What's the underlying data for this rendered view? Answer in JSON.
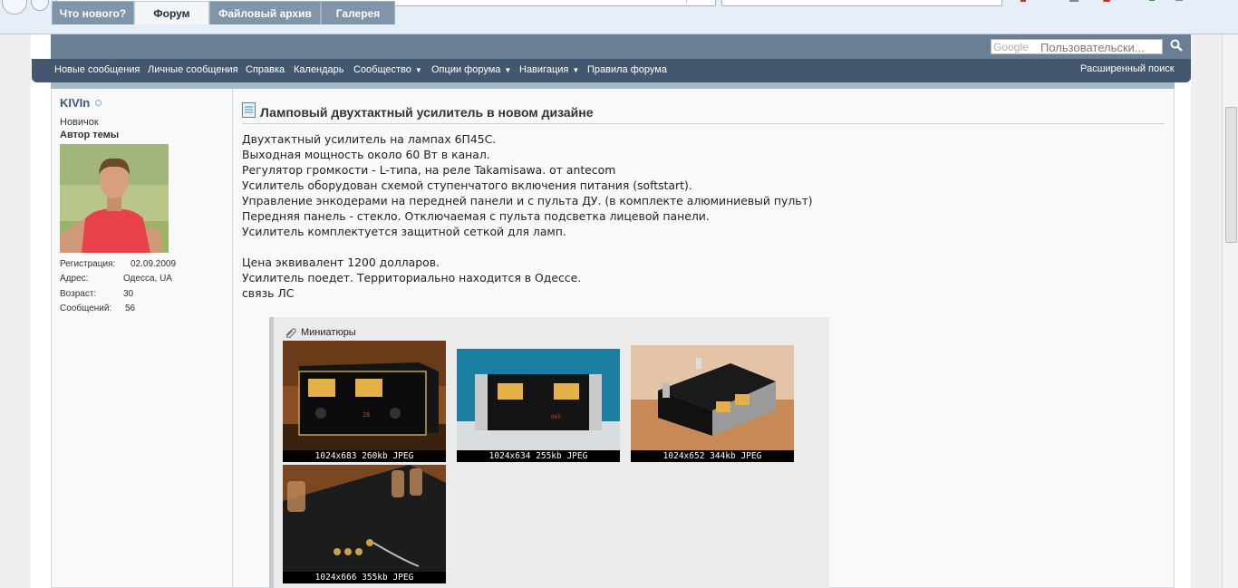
{
  "forum": {
    "tabs": [
      {
        "label": "Что нового?"
      },
      {
        "label": "Форум"
      },
      {
        "label": "Файловый архив"
      },
      {
        "label": "Галерея"
      }
    ],
    "search": {
      "engine": "Google",
      "placeholder": "Пользовательски..."
    },
    "subnav": [
      {
        "label": "Новые сообщения"
      },
      {
        "label": "Личные сообщения"
      },
      {
        "label": "Справка"
      },
      {
        "label": "Календарь"
      },
      {
        "label": "Сообщество"
      },
      {
        "label": "Опции форума"
      },
      {
        "label": "Навигация"
      },
      {
        "label": "Правила форума"
      }
    ],
    "advanced_search": "Расширенный поиск"
  },
  "user": {
    "name": "KIVIn",
    "rank": "Новичок",
    "role": "Автор темы",
    "stats": [
      {
        "label": "Регистрация:",
        "value": "02.09.2009"
      },
      {
        "label": "Адрес:",
        "value": "Одесса, UA"
      },
      {
        "label": "Возраст:",
        "value": "30"
      },
      {
        "label": "Сообщений:",
        "value": "56"
      }
    ]
  },
  "post": {
    "title": "Ламповый двухтактный усилитель в новом дизайне",
    "lines": [
      "Двухтактный усилитель на лампах 6П45С.",
      "Выходная мощность около 60 Вт в канал.",
      "Регулятор громкости - L-типа, на реле Takamisawa. от antecom",
      "Усилитель оборудован схемой ступенчатого включения питания (softstart).",
      "Управление энкодерами на передней панели и с пульта ДУ. (в комплекте алюминиевый пульт)",
      "Передняя панель - стекло. Отключаемая с пульта подсветка лицевой панели.",
      "Усилитель комплектуется защитной сеткой для ламп.",
      "",
      "Цена эквивалент 1200 долларов.",
      "Усилитель поедет. Территориально находится в Одессе.",
      "связь ЛС"
    ],
    "attachments_label": "Миниатюры",
    "attachments": [
      {
        "caption": "1024x683 260kb JPEG"
      },
      {
        "caption": "1024x634 255kb JPEG"
      },
      {
        "caption": "1024x652 344kb JPEG"
      },
      {
        "caption": "1024x666 355kb JPEG"
      }
    ]
  }
}
